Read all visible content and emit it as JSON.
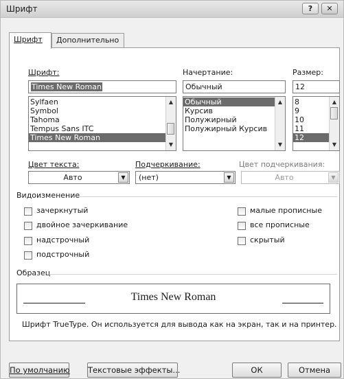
{
  "window": {
    "title": "Шрифт",
    "help_btn": "?",
    "close_btn": "✕"
  },
  "tabs": [
    {
      "label": "Шрифт",
      "active": true
    },
    {
      "label": "Дополнительно",
      "active": false
    }
  ],
  "font": {
    "label": "Шрифт:",
    "value": "Times New Roman",
    "items": [
      "Sylfaen",
      "Symbol",
      "Tahoma",
      "Tempus Sans ITC",
      "Times New Roman"
    ],
    "selected": "Times New Roman"
  },
  "style": {
    "label": "Начертание:",
    "value": "Обычный",
    "items": [
      "Обычный",
      "Курсив",
      "Полужирный",
      "Полужирный Курсив"
    ],
    "selected": "Обычный"
  },
  "size": {
    "label": "Размер:",
    "value": "12",
    "items": [
      "8",
      "9",
      "10",
      "11",
      "12"
    ],
    "selected": "12"
  },
  "color": {
    "label": "Цвет текста:",
    "value": "Авто"
  },
  "underline": {
    "label": "Подчеркивание:",
    "value": "(нет)"
  },
  "underline_color": {
    "label": "Цвет подчеркивания:",
    "value": "Авто"
  },
  "effects": {
    "title": "Видоизменение",
    "left": [
      "зачеркнутый",
      "двойное зачеркивание",
      "надстрочный",
      "подстрочный"
    ],
    "right": [
      "малые прописные",
      "все прописные",
      "скрытый"
    ]
  },
  "preview": {
    "title": "Образец",
    "sample_text": "Times New Roman",
    "description": "Шрифт TrueType. Он используется для вывода как на экран, так и на принтер."
  },
  "buttons": {
    "default": "По умолчанию",
    "text_effects": "Текстовые эффекты...",
    "ok": "ОК",
    "cancel": "Отмена"
  }
}
